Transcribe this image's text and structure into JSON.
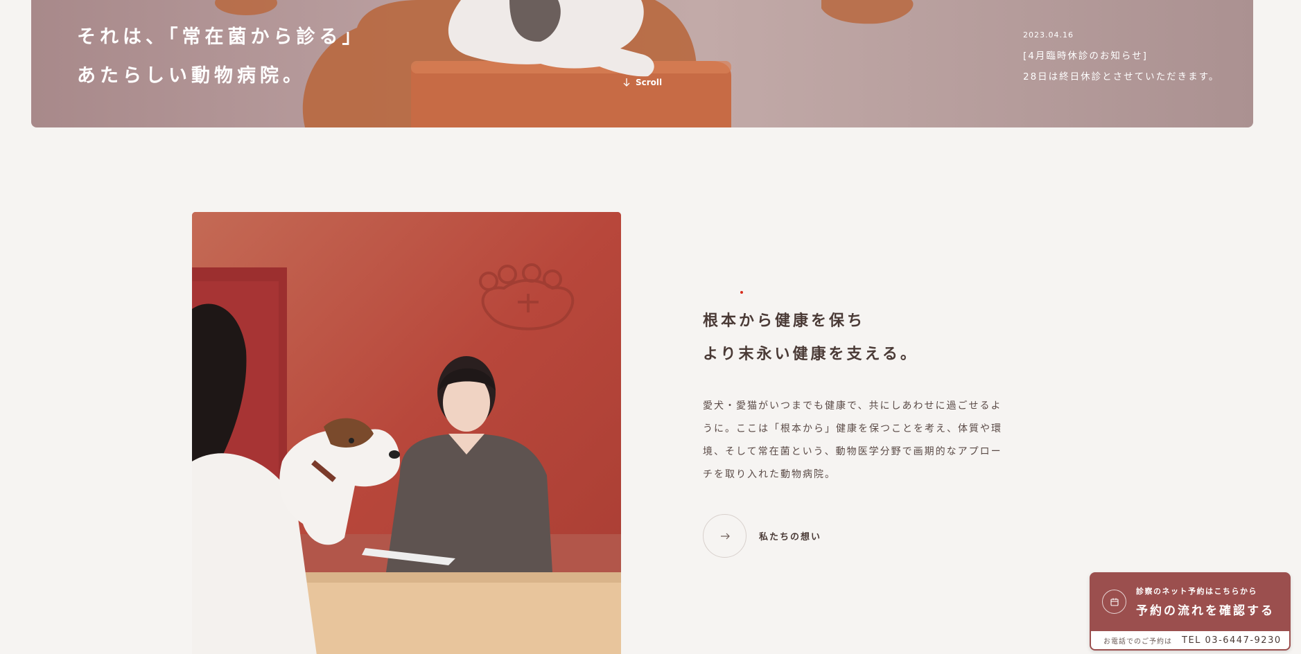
{
  "hero": {
    "tagline_line1": "それは、「常在菌から診る」",
    "tagline_line2": "あたらしい動物病院。",
    "scroll_label": "Scroll",
    "news": {
      "date": "2023.04.16",
      "title": "[4月臨時休診のお知らせ]",
      "body": "28日は終日休診とさせていただきます。"
    }
  },
  "about": {
    "headline_line1": "根本から健康を保ち",
    "headline_line2": "より末永い健康を支える。",
    "body_lines": [
      "愛犬・愛猫がいつまでも健康で、共にしあわせに過ごせるよ",
      "うに。ここは「根本から」健康を保つことを考え、体質や環",
      "境、そして常在菌という、動物医学分野で画期的なアプロー",
      "チを取り入れた動物病院。"
    ],
    "more_label": "私たちの想い"
  },
  "reservation": {
    "subtitle": "診察のネット予約はこちらから",
    "cta": "予約の流れを確認する",
    "tel_label": "お電話でのご予約は",
    "tel_number": "TEL 03-6447-9230"
  },
  "icons": {
    "scroll": "arrow-down-icon",
    "more": "arrow-right-icon",
    "reservation": "calendar-icon"
  },
  "colors": {
    "background": "#f6f4f2",
    "text": "#4a3a36",
    "accent": "#9b4f4e",
    "hero_overlay": "#b99e9f",
    "wall_red": "#b94a3e"
  }
}
